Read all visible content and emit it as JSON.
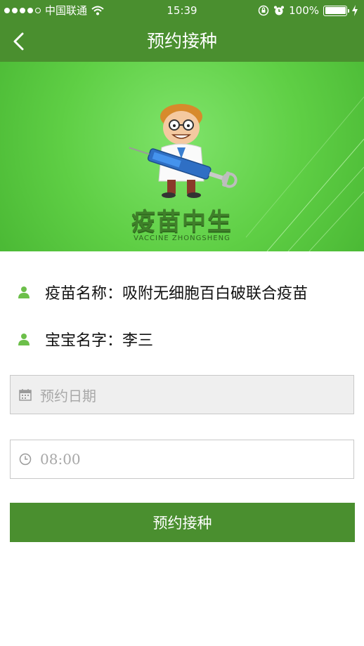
{
  "status_bar": {
    "carrier": "中国联通",
    "time": "15:39",
    "battery": "100%"
  },
  "header": {
    "title": "预约接种"
  },
  "banner": {
    "brand": "疫苗中生",
    "brand_sub": "VACCINE ZHONGSHENG"
  },
  "info": {
    "vaccine": "疫苗名称：吸附无细胞百白破联合疫苗",
    "baby": "宝宝名字：李三"
  },
  "form": {
    "date_placeholder": "预约日期",
    "time_value": "08:00"
  },
  "actions": {
    "submit_label": "预约接种"
  },
  "colors": {
    "primary": "#4a8f2f",
    "banner": "#5fcf45",
    "icon_green": "#6cbf4a"
  }
}
